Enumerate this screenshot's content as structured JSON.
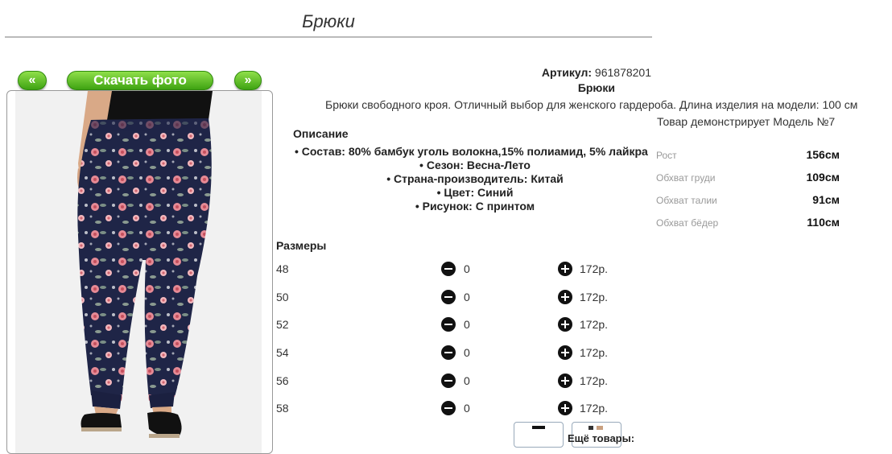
{
  "page": {
    "title": "Брюки"
  },
  "nav": {
    "prev_label": "«",
    "download_label": "Скачать фото",
    "next_label": "»"
  },
  "product": {
    "sku_label": "Артикул:",
    "sku_value": "961878201",
    "name": "Брюки",
    "description": "Брюки свободного кроя. Отличный выбор для женского гардероба. Длина изделия на модели: 100 см"
  },
  "specs": {
    "heading": "Описание",
    "items": [
      "Состав: 80% бамбук уголь волокна,15% полиамид, 5% лайкра",
      "Сезон: Весна-Лето",
      "Страна-производитель: Китай",
      "Цвет: Синий",
      "Рисунок: С принтом"
    ]
  },
  "model": {
    "title": "Товар демонстрирует Модель №7",
    "rows": [
      {
        "label": "Рост",
        "value": "156см"
      },
      {
        "label": "Обхват груди",
        "value": "109см"
      },
      {
        "label": "Обхват талии",
        "value": "91см"
      },
      {
        "label": "Обхват бёдер",
        "value": "110см"
      }
    ]
  },
  "sizes": {
    "heading": "Размеры",
    "rows": [
      {
        "size": "48",
        "qty": "0",
        "price": "172р."
      },
      {
        "size": "50",
        "qty": "0",
        "price": "172р."
      },
      {
        "size": "52",
        "qty": "0",
        "price": "172р."
      },
      {
        "size": "54",
        "qty": "0",
        "price": "172р."
      },
      {
        "size": "56",
        "qty": "0",
        "price": "172р."
      },
      {
        "size": "58",
        "qty": "0",
        "price": "172р."
      }
    ]
  },
  "more": {
    "label": "Ещё товары:"
  },
  "icons": {
    "minus": "minus-circle-icon",
    "plus": "plus-circle-icon"
  },
  "colors": {
    "button_green": "#3fa312",
    "print_navy": "#1f2547",
    "print_rose": "#e58a95"
  }
}
